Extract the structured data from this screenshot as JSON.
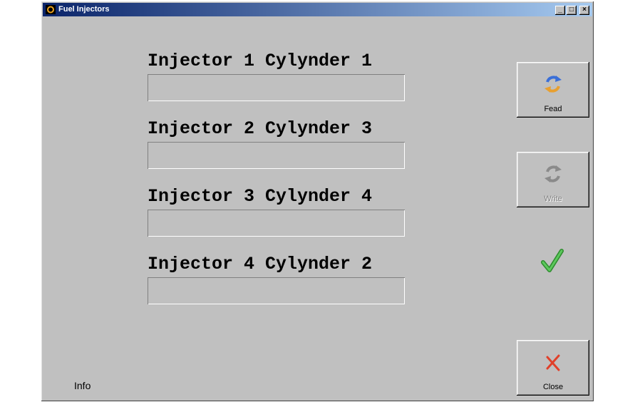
{
  "window": {
    "title": "Fuel Injectors",
    "icon": "app-icon",
    "controls": {
      "minimize": "_",
      "maximize": "□",
      "close": "×"
    }
  },
  "injectors": [
    {
      "label": "Injector 1 Cylynder 1",
      "value": ""
    },
    {
      "label": "Injector 2 Cylynder 3",
      "value": ""
    },
    {
      "label": "Injector 3 Cylynder 4",
      "value": ""
    },
    {
      "label": "Injector 4 Cylynder 2",
      "value": ""
    }
  ],
  "buttons": {
    "read": {
      "label": "Fead",
      "icon": "refresh-icon",
      "enabled": true
    },
    "write": {
      "label": "Write",
      "icon": "write-icon",
      "enabled": false
    },
    "close": {
      "label": "Close",
      "icon": "close-x-icon"
    }
  },
  "status": {
    "check_icon": "check-icon",
    "check_color": "#3caa3c"
  },
  "info": {
    "label": "Info"
  },
  "colors": {
    "face": "#c0c0c0",
    "title_start": "#0a246a",
    "title_end": "#a6caf0",
    "close_x": "#e0402a"
  }
}
